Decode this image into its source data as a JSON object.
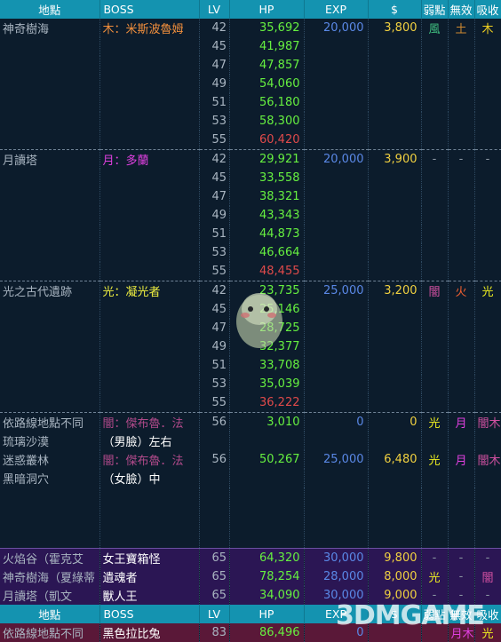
{
  "header": {
    "location": "地點",
    "boss": "BOSS",
    "lv": "LV",
    "hp": "HP",
    "exp": "EXP",
    "money": "$",
    "weak": "弱點",
    "null": "無效",
    "absorb": "吸收"
  },
  "rows": [
    {
      "loc": "神奇樹海",
      "boss": "木：米斯波魯姆",
      "lv": "42",
      "hp": "35,692",
      "exp": "20,000",
      "money": "3,800",
      "weak": "風",
      "nul": "土",
      "abs": "木"
    },
    {
      "lv": "45",
      "hp": "41,987"
    },
    {
      "lv": "47",
      "hp": "47,857"
    },
    {
      "lv": "49",
      "hp": "54,060"
    },
    {
      "lv": "51",
      "hp": "56,180"
    },
    {
      "lv": "53",
      "hp": "58,300"
    },
    {
      "lv": "55",
      "hp": "60,420"
    },
    {
      "loc": "月讀塔",
      "boss": "月：多蘭",
      "lv": "42",
      "hp": "29,921",
      "exp": "20,000",
      "money": "3,900",
      "weak": "-",
      "nul": "-",
      "abs": "-"
    },
    {
      "lv": "45",
      "hp": "33,558"
    },
    {
      "lv": "47",
      "hp": "38,321"
    },
    {
      "lv": "49",
      "hp": "43,343"
    },
    {
      "lv": "51",
      "hp": "44,873"
    },
    {
      "lv": "53",
      "hp": "46,664"
    },
    {
      "lv": "55",
      "hp": "48,455"
    },
    {
      "loc": "光之古代遺跡",
      "boss": "光：凝光者",
      "lv": "42",
      "hp": "23,735",
      "exp": "25,000",
      "money": "3,200",
      "weak": "闇",
      "nul": "火",
      "abs": "光"
    },
    {
      "lv": "45",
      "hp": "25,146"
    },
    {
      "lv": "47",
      "hp": "28,725"
    },
    {
      "lv": "49",
      "hp": "32,377"
    },
    {
      "lv": "51",
      "hp": "33,708"
    },
    {
      "lv": "53",
      "hp": "35,039"
    },
    {
      "lv": "55",
      "hp": "36,222"
    },
    {
      "loc": "依路線地點不同",
      "boss": "闇：傑布魯．法",
      "lv": "56",
      "hp": "3,010",
      "exp": "0",
      "money": "0",
      "weak": "光",
      "nul": "月",
      "abs": "闇木"
    },
    {
      "loc": "琉璃沙漠",
      "boss": "（男臉）左右"
    },
    {
      "loc": "迷惑叢林",
      "boss": "闇：傑布魯．法",
      "lv": "56",
      "hp": "50,267",
      "exp": "25,000",
      "money": "6,480",
      "weak": "光",
      "nul": "月",
      "abs": "闇木"
    },
    {
      "loc": "黑暗洞穴",
      "boss": "（女臉）中"
    },
    {
      "loc": "火焰谷（霍克艾",
      "boss": "女王寶箱怪",
      "lv": "65",
      "hp": "64,320",
      "exp": "30,000",
      "money": "9,800",
      "weak": "-",
      "nul": "-",
      "abs": "-"
    },
    {
      "loc": "神奇樹海（夏綠蒂",
      "boss": "遺魂者",
      "lv": "65",
      "hp": "78,254",
      "exp": "28,000",
      "money": "8,000",
      "weak": "光",
      "nul": "-",
      "abs": "闇"
    },
    {
      "loc": "月讀塔（凱文",
      "boss": "獸人王",
      "lv": "65",
      "hp": "34,090",
      "exp": "30,000",
      "money": "9,000",
      "weak": "-",
      "nul": "-",
      "abs": "-"
    },
    {
      "loc": "依路線地點不同",
      "boss": "黑色拉比兔",
      "lv": "83",
      "hp": "86,496",
      "exp": "0",
      "money": "",
      "weak": "",
      "nul": "月木",
      "abs": "光"
    }
  ],
  "watermark": "3DMGAME",
  "colors": {
    "header_bg": "#1493b0",
    "page_bg": "#0c1c2c",
    "purple_row": "#2b1654",
    "maroon_row": "#5a1838",
    "hp_green": "#66f040",
    "hp_red": "#e04a4a",
    "exp_blue": "#5a88e6",
    "money_yellow": "#f0d040"
  }
}
